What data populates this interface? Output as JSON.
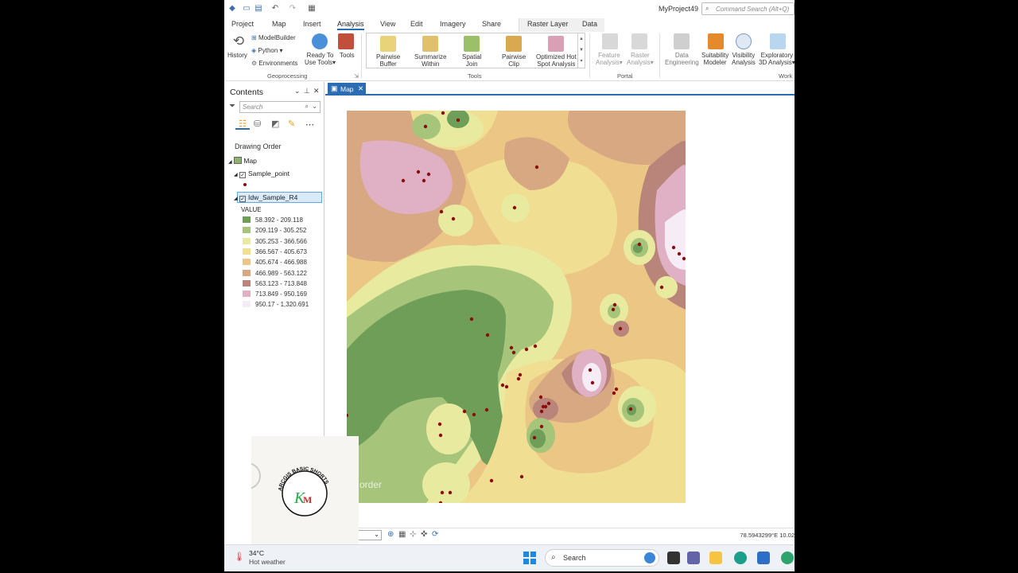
{
  "window": {
    "project_title": "MyProject49",
    "command_search_placeholder": "Command Search (Alt+Q)"
  },
  "tabs": [
    "Project",
    "Map",
    "Insert",
    "Analysis",
    "View",
    "Edit",
    "Imagery",
    "Share"
  ],
  "active_tab": "Analysis",
  "context_tabs": [
    "Raster Layer",
    "Data"
  ],
  "ribbon": {
    "history": "History",
    "modelbuilder": "ModelBuilder",
    "python": "Python",
    "environments": "Environments",
    "ready_to_use_1": "Ready To",
    "ready_to_use_2": "Use Tools",
    "tools": "Tools",
    "geoprocessing_group": "Geoprocessing",
    "gallery": [
      {
        "l1": "Pairwise",
        "l2": "Buffer"
      },
      {
        "l1": "Summarize",
        "l2": "Within"
      },
      {
        "l1": "Spatial",
        "l2": "Join"
      },
      {
        "l1": "Pairwise",
        "l2": "Clip"
      },
      {
        "l1": "Optimized Hot",
        "l2": "Spot Analysis"
      }
    ],
    "tools_group": "Tools",
    "feature_analysis_1": "Feature",
    "feature_analysis_2": "Analysis",
    "raster_analysis_1": "Raster",
    "raster_analysis_2": "Analysis",
    "portal_group": "Portal",
    "data_engineering_1": "Data",
    "data_engineering_2": "Engineering",
    "suitability_1": "Suitability",
    "suitability_2": "Modeler",
    "visibility_1": "Visibility",
    "visibility_2": "Analysis",
    "exploratory_1": "Exploratory",
    "exploratory_2": "3D Analysis",
    "workflows_group": "Work"
  },
  "contents": {
    "title": "Contents",
    "search_placeholder": "Search",
    "drawing_order": "Drawing Order",
    "map_label": "Map",
    "layer_points": "Sample_point",
    "layer_raster": "Idw_Sample_R4",
    "value_label": "VALUE",
    "legend": [
      {
        "label": "58.392 - 209.118",
        "color": "#6f9e58"
      },
      {
        "label": "209.119 - 305.252",
        "color": "#a6c57a"
      },
      {
        "label": "305.253 - 366.566",
        "color": "#e7ea9f"
      },
      {
        "label": "366.567 - 405.673",
        "color": "#f0df93"
      },
      {
        "label": "405.674 - 466.988",
        "color": "#ebc685"
      },
      {
        "label": "466.989 - 563.122",
        "color": "#d8a882"
      },
      {
        "label": "563.123 - 713.848",
        "color": "#b98479"
      },
      {
        "label": "713.849 - 950.169",
        "color": "#e0b0c4"
      },
      {
        "label": "950.17 - 1,320.691",
        "color": "#f5ecf5"
      }
    ]
  },
  "map": {
    "tab_label": "Map",
    "watermark_text": "order",
    "coords": "78.5943299°E 10.02"
  },
  "logo": {
    "arc_text": "ARCGIS BASIC SHORTS",
    "monogram_k": "K",
    "monogram_m": "M"
  },
  "taskbar": {
    "temp": "34°C",
    "weather": "Hot weather",
    "search_label": "Search"
  }
}
